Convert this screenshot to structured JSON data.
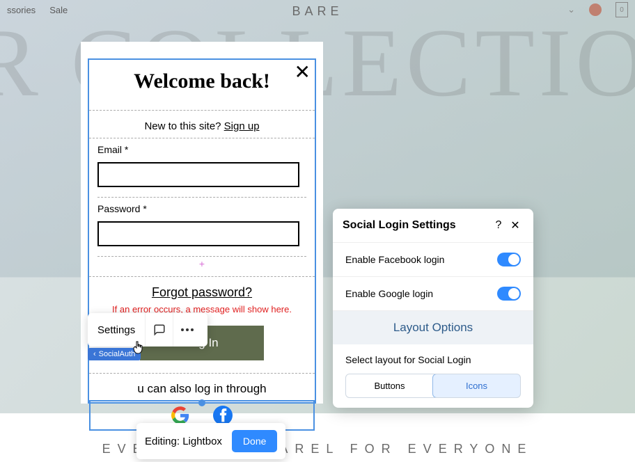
{
  "header": {
    "nav1": "ssories",
    "nav2": "Sale",
    "brand": "BARE",
    "bag_count": "0"
  },
  "bg_text": "ER COLLECTION",
  "footer_text": "EVERYDAY APPAREL FOR EVERYONE",
  "lightbox": {
    "title": "Welcome back!",
    "new_prompt": "New to this site? ",
    "signup": "Sign up",
    "email_label": "Email *",
    "password_label": "Password *",
    "forgot": "Forgot password?",
    "error": "If an error occurs, a message will show here.",
    "login_btn": "Log In",
    "also_text": "u can also log in through"
  },
  "toolbar": {
    "settings": "Settings",
    "badge": "SocialAuth"
  },
  "editing_bar": {
    "label": "Editing: Lightbox",
    "done": "Done"
  },
  "panel": {
    "title": "Social Login Settings",
    "fb": "Enable Facebook login",
    "google": "Enable Google login",
    "layout_header": "Layout Options",
    "layout_desc": "Select layout for Social Login",
    "opt_buttons": "Buttons",
    "opt_icons": "Icons"
  }
}
